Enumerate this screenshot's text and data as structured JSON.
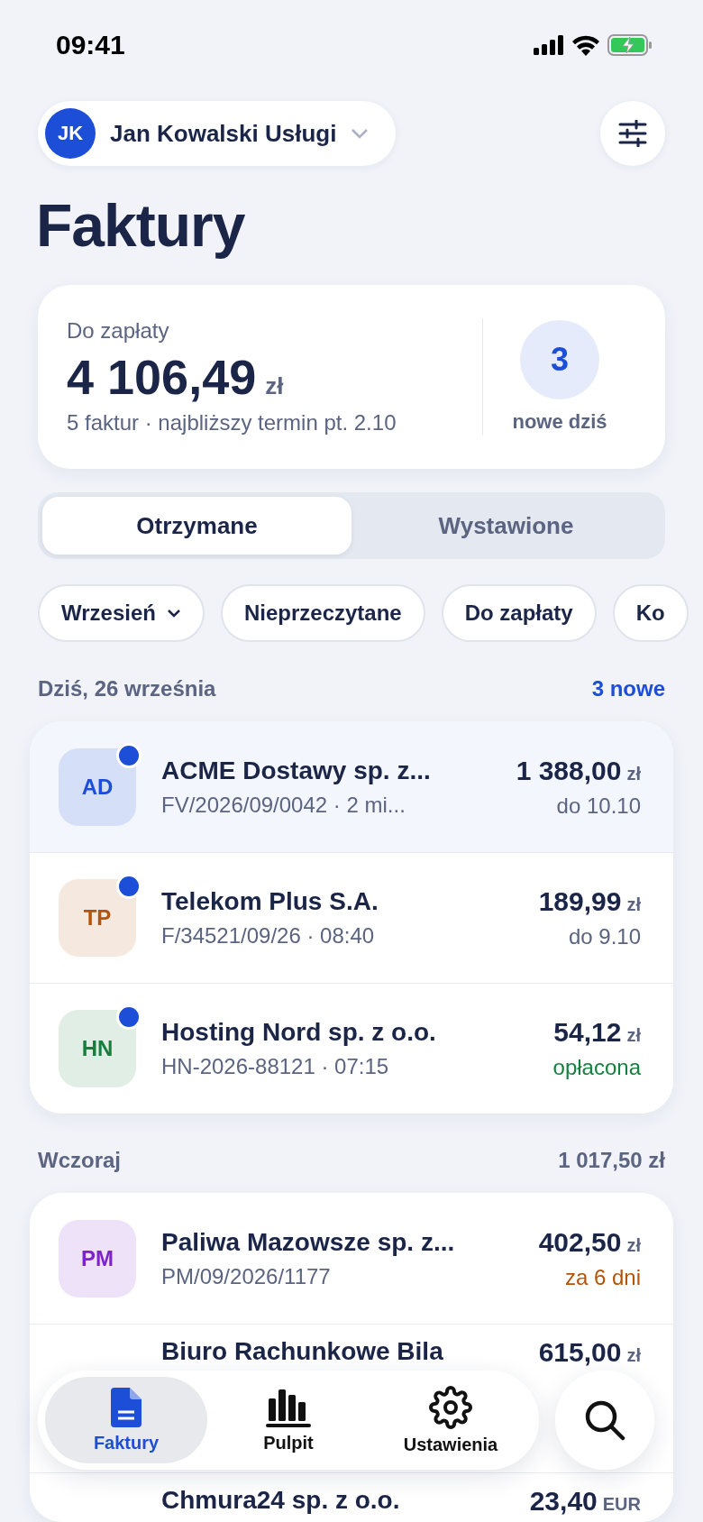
{
  "status_bar": {
    "time": "09:41"
  },
  "header": {
    "account": {
      "initials": "JK",
      "name": "Jan Kowalski Usługi"
    }
  },
  "title": "Faktury",
  "summary": {
    "label": "Do zapłaty",
    "amount": "4 106,49",
    "currency": "zł",
    "details": "5 faktur · najbliższy termin pt. 2.10",
    "new_count": "3",
    "new_label": "nowe dziś"
  },
  "tabs": [
    {
      "label": "Otrzymane",
      "selected": true
    },
    {
      "label": "Wystawione",
      "selected": false
    }
  ],
  "filters": [
    {
      "label": "Wrzesień",
      "kind": "dropdown"
    },
    {
      "label": "Nieprzeczytane",
      "kind": "chip"
    },
    {
      "label": "Do zapłaty",
      "kind": "chip"
    },
    {
      "label": "Ko",
      "kind": "chip"
    }
  ],
  "sections": [
    {
      "title": "Dziś, 26 września",
      "link": "3 nowe",
      "invoices": [
        {
          "initials": "AD",
          "color": "#1d4ed8",
          "unread": true,
          "selected": true,
          "name": "ACME Dostawy sp. z...",
          "subtitle": "FV/2026/09/0042 · 2 mi...",
          "amount": "1 388,00",
          "currency": "zł",
          "status": {
            "text": "do 10.10",
            "color": "#5b6480"
          }
        },
        {
          "initials": "TP",
          "color": "#b45309",
          "unread": true,
          "selected": false,
          "name": "Telekom Plus S.A.",
          "subtitle": "F/34521/09/26 · 08:40",
          "amount": "189,99",
          "currency": "zł",
          "status": {
            "text": "do 9.10",
            "color": "#5b6480"
          }
        },
        {
          "initials": "HN",
          "color": "#15803d",
          "unread": true,
          "selected": false,
          "name": "Hosting Nord sp. z o.o.",
          "subtitle": "HN-2026-88121 · 07:15",
          "amount": "54,12",
          "currency": "zł",
          "status": {
            "text": "opłacona",
            "color": "#15803d"
          }
        }
      ]
    },
    {
      "title": "Wczoraj",
      "total": "1 017,50 zł",
      "invoices": [
        {
          "initials": "PM",
          "color": "#7e22ce",
          "unread": false,
          "selected": false,
          "name": "Paliwa Mazowsze sp. z...",
          "subtitle": "PM/09/2026/1177",
          "amount": "402,50",
          "currency": "zł",
          "status": {
            "text": "za 6 dni",
            "color": "#b45309"
          }
        },
        {
          "unread": false,
          "selected": false,
          "name": "Biuro Rachunkowe Bila",
          "amount": "615,00",
          "currency": "zł"
        },
        {
          "unread": false,
          "selected": false,
          "name": "Chmura24 sp. z o.o.",
          "amount": "23,40",
          "currency": "EUR"
        }
      ]
    }
  ],
  "bottom_nav": [
    {
      "label": "Faktury",
      "selected": true
    },
    {
      "label": "Pulpit",
      "selected": false
    },
    {
      "label": "Ustawienia",
      "selected": false
    }
  ]
}
